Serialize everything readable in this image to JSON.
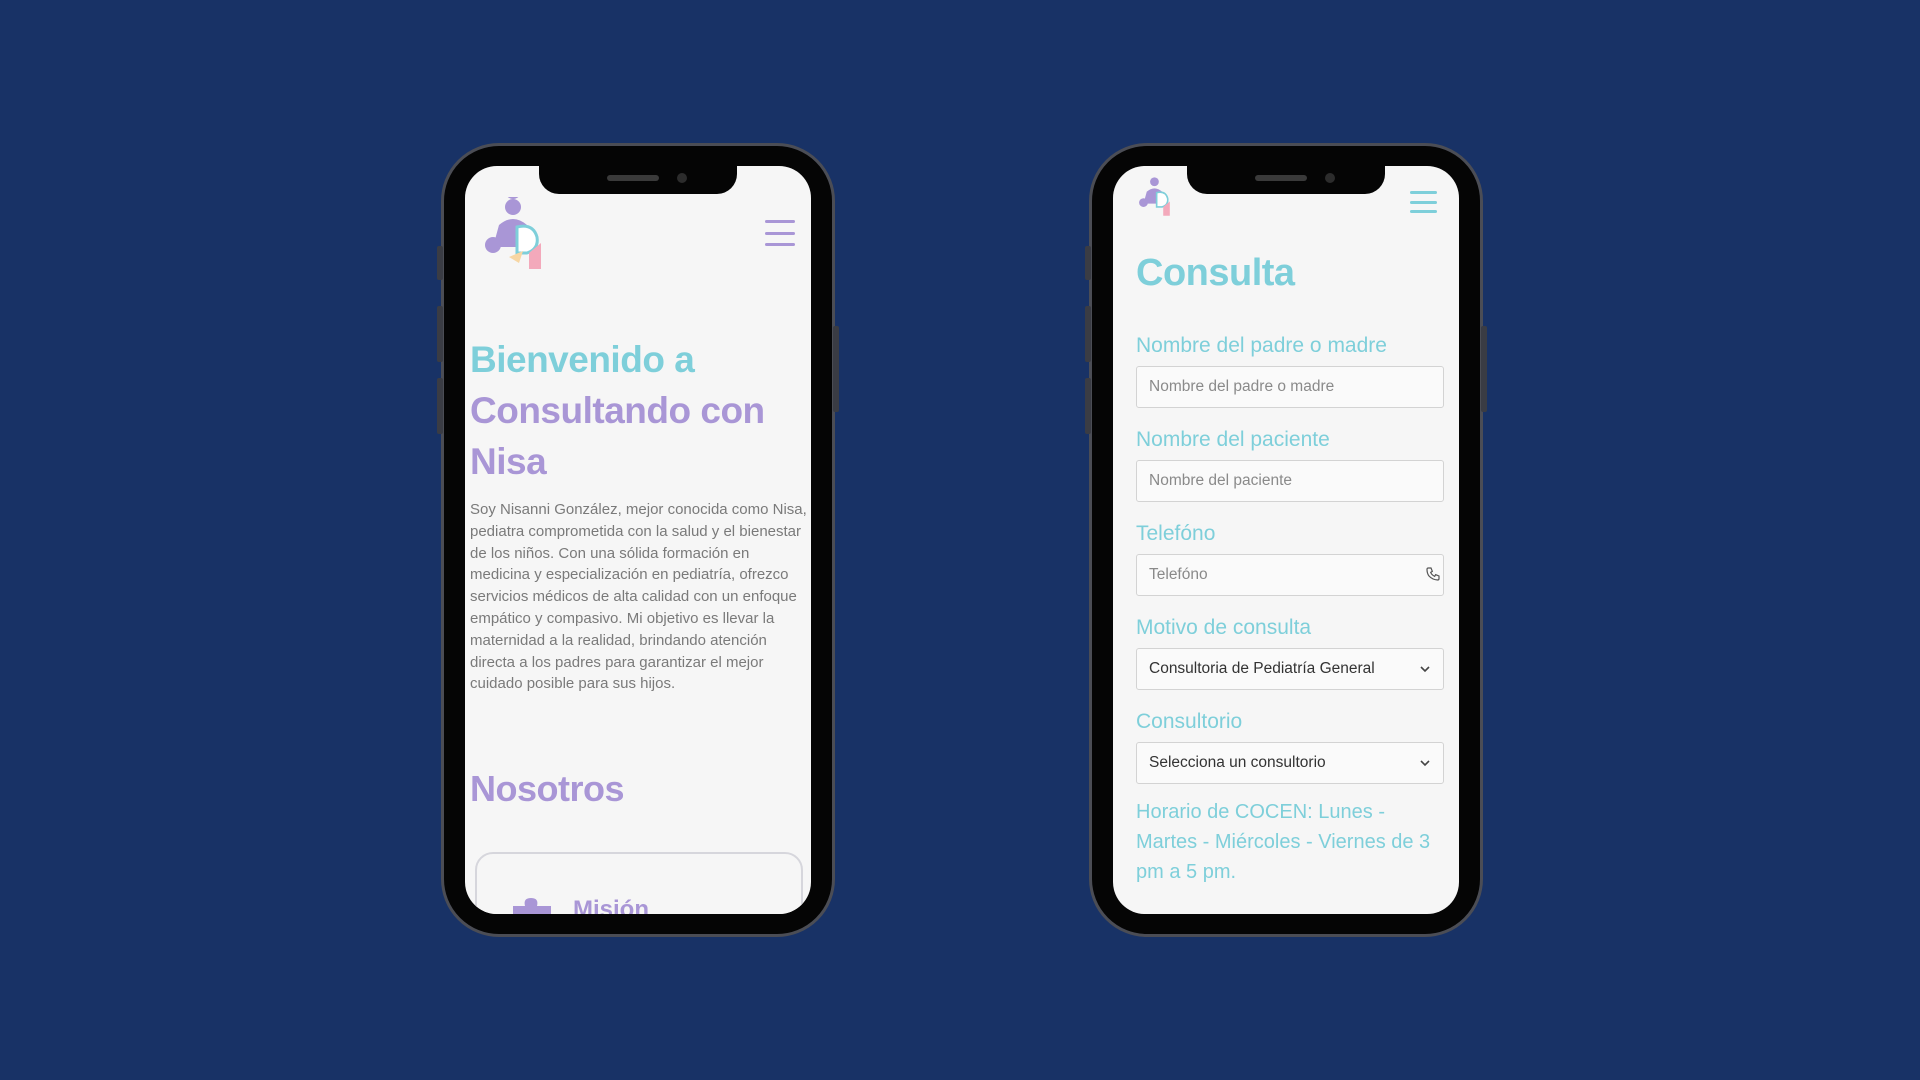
{
  "colors": {
    "background": "#183266",
    "accent_teal": "#7ecfda",
    "accent_purple": "#a996d6",
    "body_text": "#7a7a7a"
  },
  "home": {
    "logo_icon": "puzzle-family-logo",
    "menu_icon": "hamburger-menu-icon",
    "title_line1": "Bienvenido a",
    "title_line2": "Consultando con Nisa",
    "intro": "Soy Nisanni González, mejor conocida como Nisa, pediatra comprometida con la salud y el bienestar de los niños. Con una sólida formación en medicina y especialización en pediatría, ofrezco servicios médicos de alta calidad con un enfoque empático y compasivo. Mi objetivo es llevar la maternidad a la realidad, brindando atención directa a los padres para garantizar el mejor cuidado posible para sus hijos.",
    "section_title": "Nosotros",
    "mission_label": "Misión"
  },
  "consulta": {
    "logo_icon": "puzzle-family-logo",
    "menu_icon": "hamburger-menu-icon",
    "title": "Consulta",
    "parent_label": "Nombre del padre o madre",
    "parent_placeholder": "Nombre del padre o madre",
    "patient_label": "Nombre del paciente",
    "patient_placeholder": "Nombre del paciente",
    "phone_label": "Telefóno",
    "phone_placeholder": "Telefóno",
    "reason_label": "Motivo de consulta",
    "reason_value": "Consultoria de Pediatría General",
    "office_label": "Consultorio",
    "office_value": "Selecciona un consultorio",
    "schedule": "Horario de COCEN: Lunes - Martes - Miércoles - Viernes de 3 pm a 5 pm."
  }
}
